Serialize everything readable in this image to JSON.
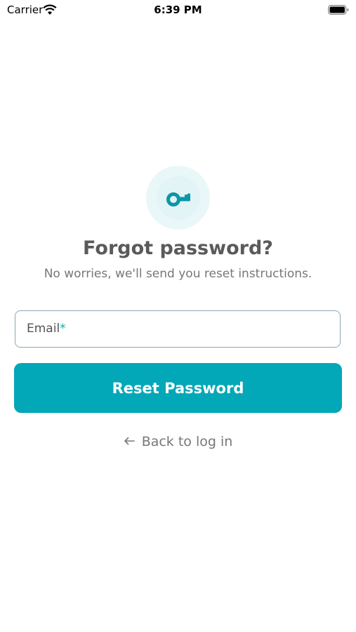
{
  "status_bar": {
    "carrier": "Carrier",
    "time": "6:39 PM",
    "wifi_icon": "wifi-icon",
    "battery_icon": "battery-icon"
  },
  "badge": {
    "icon": "key-icon",
    "icon_color": "#0a97a8",
    "background": "#eaf7f8"
  },
  "header": {
    "title": "Forgot password?",
    "subtitle": "No worries, we'll send you reset instructions."
  },
  "form": {
    "email_label": "Email",
    "required_marker": "*",
    "email_value": ""
  },
  "actions": {
    "reset_label": "Reset Password",
    "back_label": "Back to log in",
    "back_icon": "arrow-left-icon"
  },
  "colors": {
    "accent": "#03a8b8",
    "title": "#5a5a5a",
    "muted": "#777777",
    "input_border": "#8aa7b4"
  }
}
